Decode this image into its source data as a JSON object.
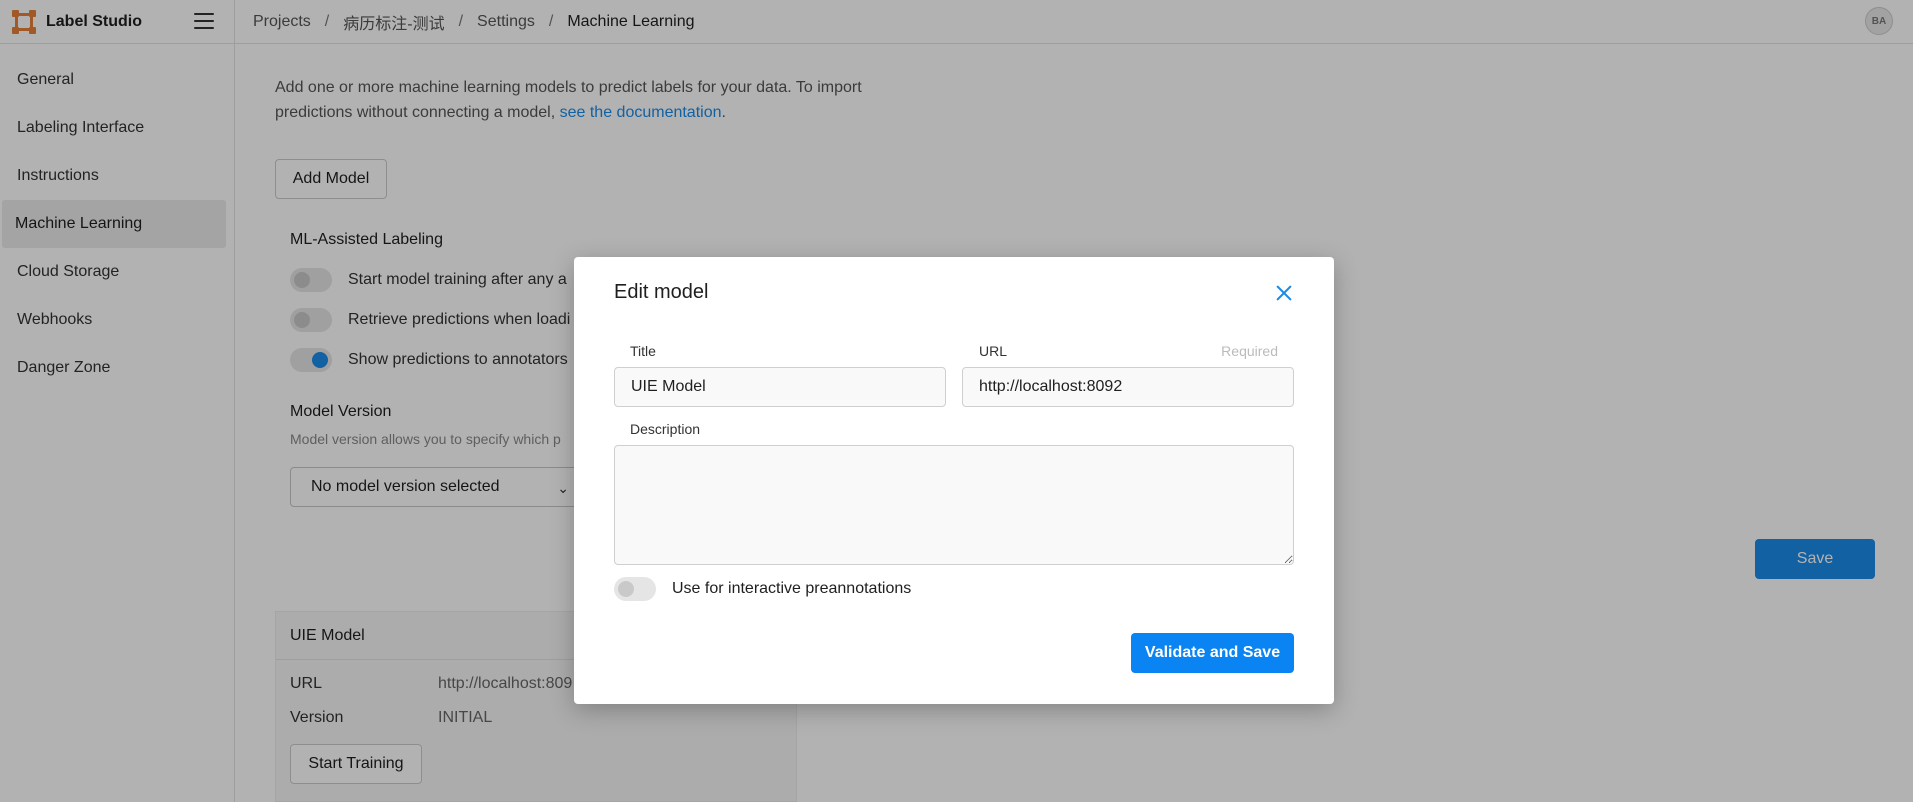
{
  "app": {
    "name": "Label Studio",
    "avatar_initials": "BA"
  },
  "breadcrumb": [
    "Projects",
    "病历标注-测试",
    "Settings",
    "Machine Learning"
  ],
  "sidebar": {
    "items": [
      {
        "label": "General",
        "active": false
      },
      {
        "label": "Labeling Interface",
        "active": false
      },
      {
        "label": "Instructions",
        "active": false
      },
      {
        "label": "Machine Learning",
        "active": true
      },
      {
        "label": "Cloud Storage",
        "active": false
      },
      {
        "label": "Webhooks",
        "active": false
      },
      {
        "label": "Danger Zone",
        "active": false
      }
    ]
  },
  "main": {
    "intro_text": "Add one or more machine learning models to predict labels for your data. To import predictions without connecting a model, ",
    "intro_link": "see the documentation",
    "intro_end": ".",
    "add_model_label": "Add Model",
    "ml_assisted": {
      "title": "ML-Assisted Labeling",
      "toggles": [
        {
          "label": "Start model training after any a",
          "on": false
        },
        {
          "label": "Retrieve predictions when loadi",
          "on": false
        },
        {
          "label": "Show predictions to annotators",
          "on": true
        }
      ]
    },
    "model_version": {
      "title": "Model Version",
      "hint": "Model version allows you to specify which p",
      "selected": "No model version selected"
    },
    "save_label": "Save",
    "model_card": {
      "title": "UIE Model",
      "url_label": "URL",
      "url_value": "http://localhost:809",
      "version_label": "Version",
      "version_value": "INITIAL",
      "train_label": "Start Training"
    }
  },
  "modal": {
    "title": "Edit model",
    "title_label": "Title",
    "title_value": "UIE Model",
    "url_label": "URL",
    "url_required": "Required",
    "url_value": "http://localhost:8092",
    "description_label": "Description",
    "description_value": "",
    "interactive_label": "Use for interactive preannotations",
    "interactive_on": false,
    "submit_label": "Validate and Save"
  },
  "colors": {
    "accent": "#1a8be8",
    "primary_button": "#0a84f3",
    "logo": "#e8803a"
  }
}
